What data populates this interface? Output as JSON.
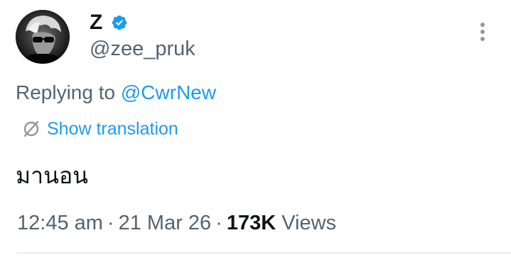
{
  "author": {
    "display_name": "Z",
    "handle": "@zee_pruk",
    "verified": true,
    "avatar_icon": "profile-avatar"
  },
  "reply": {
    "prefix": "Replying to ",
    "mention": "@CwrNew"
  },
  "translation": {
    "label": "Show translation",
    "icon": "translate-icon"
  },
  "tweet": {
    "text": "มานอน"
  },
  "meta": {
    "time": "12:45 am",
    "date": "21 Mar 26",
    "separator": "·",
    "views_count": "173K",
    "views_label": "Views"
  },
  "colors": {
    "accent": "#1d9bf0",
    "secondary_text": "#536471",
    "primary_text": "#0f1419",
    "divider": "#cfd9de"
  }
}
